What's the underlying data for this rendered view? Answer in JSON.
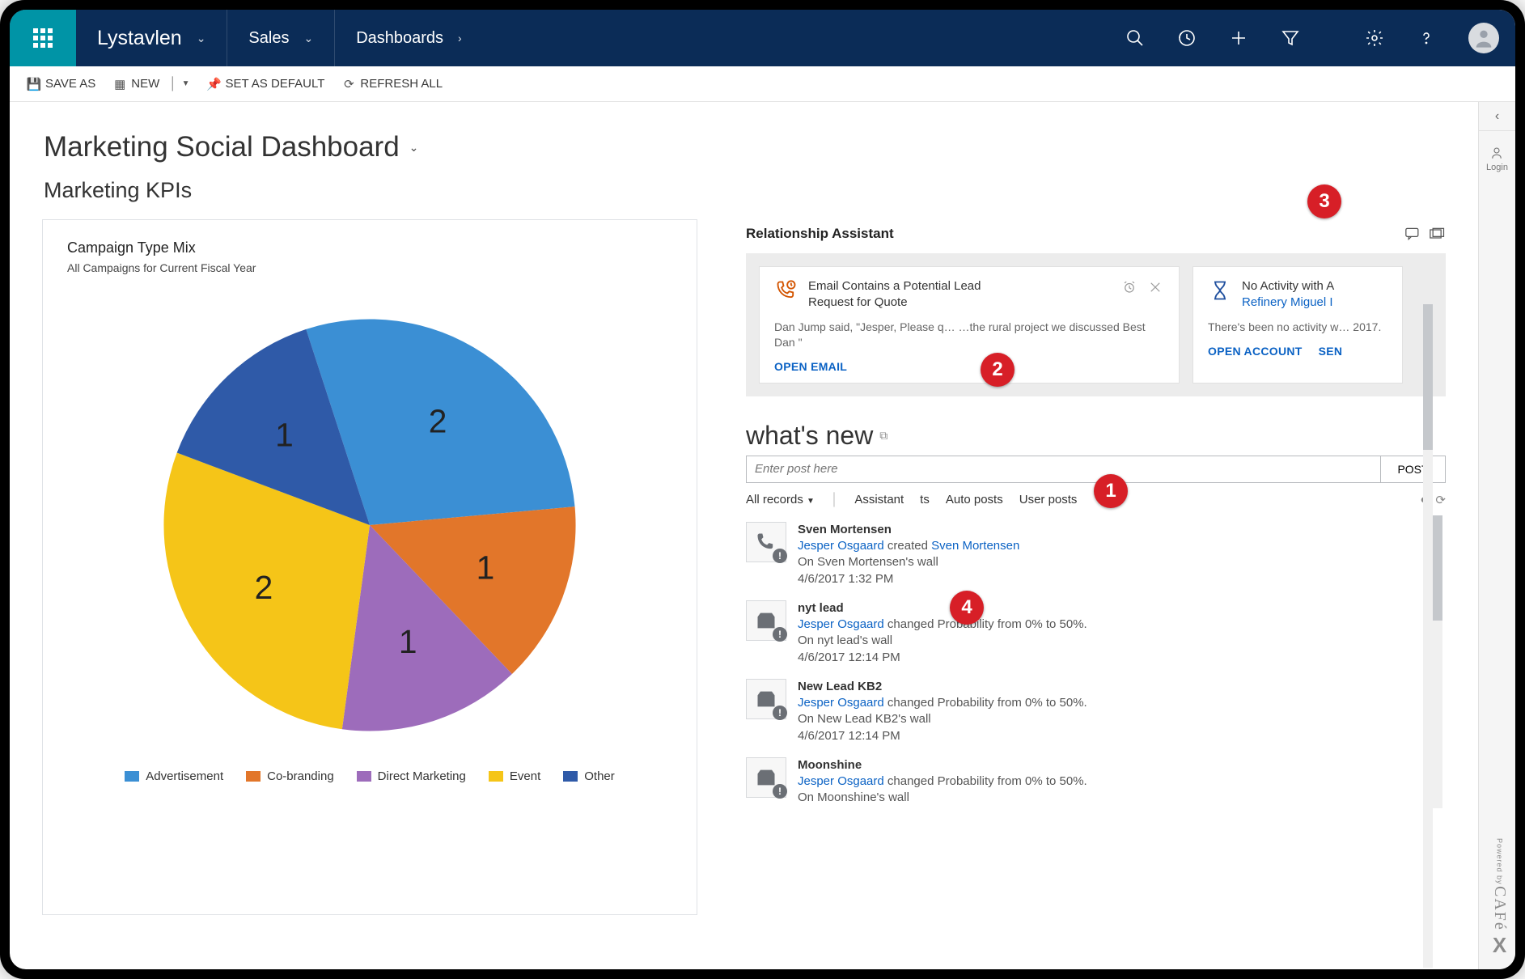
{
  "nav": {
    "app": "Lystavlen",
    "module": "Sales",
    "breadcrumb": "Dashboards"
  },
  "commands": {
    "saveAs": "SAVE AS",
    "new": "NEW",
    "setDefault": "SET AS DEFAULT",
    "refresh": "REFRESH ALL"
  },
  "rightpane": {
    "login": "Login"
  },
  "dashboard": {
    "title": "Marketing Social Dashboard",
    "section": "Marketing KPIs"
  },
  "chart_data": {
    "type": "pie",
    "title": "Campaign Type Mix",
    "subtitle": "All Campaigns for Current Fiscal Year",
    "categories": [
      "Advertisement",
      "Co-branding",
      "Direct Marketing",
      "Event",
      "Other"
    ],
    "values": [
      2,
      1,
      1,
      2,
      1
    ],
    "colors": [
      "#3b8fd4",
      "#e2762a",
      "#9d6cbb",
      "#f5c518",
      "#2f5aa8"
    ]
  },
  "ra": {
    "title": "Relationship Assistant",
    "cards": [
      {
        "line1": "Email Contains a Potential Lead",
        "line2": "Request for Quote",
        "body": "Dan Jump said, \"Jesper, Please q…  …the rural project we discussed Best Dan \"",
        "action": "OPEN EMAIL"
      },
      {
        "line1": "No Activity with A",
        "line2link": "Refinery Miguel I",
        "body": "There's been no activity w… 2017.",
        "action1": "OPEN ACCOUNT",
        "action2": "SEN"
      }
    ]
  },
  "wn": {
    "title": "what's new",
    "placeholder": "Enter post here",
    "post": "POST",
    "filters": {
      "all": "All records",
      "assistant": "Assistant",
      "both": "ts",
      "auto": "Auto posts",
      "user": "User posts"
    },
    "items": [
      {
        "icon": "phone",
        "name": "Sven Mortensen",
        "actor": "Jesper Osgaard",
        "verb": " created ",
        "target": "Sven Mortensen",
        "wall": "On Sven Mortensen's wall",
        "time": "4/6/2017 1:32 PM"
      },
      {
        "icon": "box",
        "name": "nyt lead",
        "actor": "Jesper Osgaard",
        "verb": " changed Probability from 0% to 50%.",
        "target": "",
        "wall": "On nyt lead's wall",
        "time": "4/6/2017 12:14 PM"
      },
      {
        "icon": "box",
        "name": "New Lead KB2",
        "actor": "Jesper Osgaard",
        "verb": " changed Probability from 0% to 50%.",
        "target": "",
        "wall": "On New Lead KB2's wall",
        "time": "4/6/2017 12:14 PM"
      },
      {
        "icon": "box",
        "name": "Moonshine",
        "actor": "Jesper Osgaard",
        "verb": " changed Probability from 0% to 50%.",
        "target": "",
        "wall": "On Moonshine's wall",
        "time": ""
      }
    ]
  },
  "callouts": [
    "1",
    "2",
    "3",
    "4"
  ],
  "brand": {
    "powered": "Powered by",
    "name": "CAFé",
    "x": "X"
  }
}
